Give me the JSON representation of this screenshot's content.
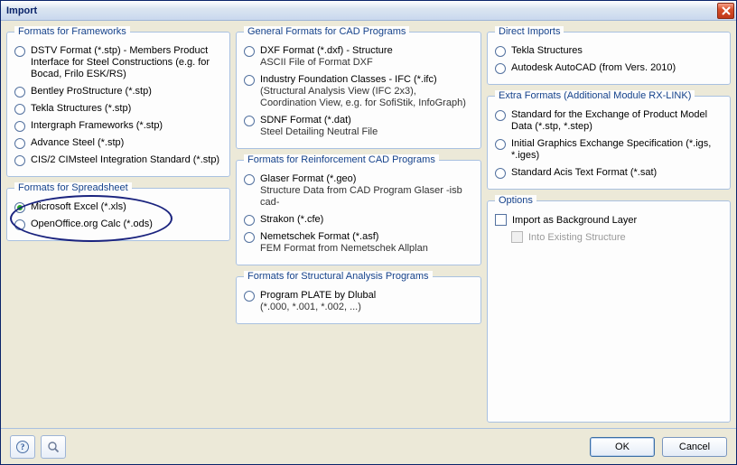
{
  "window": {
    "title": "Import"
  },
  "frameworks": {
    "legend": "Formats for Frameworks",
    "items": [
      {
        "label": "DSTV Format (*.stp) - Members Product Interface for Steel Constructions (e.g. for Bocad, Frilo ESK/RS)"
      },
      {
        "label": "Bentley ProStructure (*.stp)"
      },
      {
        "label": "Tekla Structures (*.stp)"
      },
      {
        "label": "Intergraph Frameworks (*.stp)"
      },
      {
        "label": "Advance Steel (*.stp)"
      },
      {
        "label": "CIS/2 CIMsteel Integration Standard (*.stp)"
      }
    ]
  },
  "spreadsheet": {
    "legend": "Formats for Spreadsheet",
    "items": [
      {
        "label": "Microsoft Excel (*.xls)",
        "selected": true
      },
      {
        "label": "OpenOffice.org Calc (*.ods)"
      }
    ]
  },
  "cad_general": {
    "legend": "General Formats for CAD Programs",
    "items": [
      {
        "label": "DXF Format (*.dxf) - Structure",
        "sub": "ASCII File of Format DXF"
      },
      {
        "label": "Industry Foundation Classes - IFC (*.ifc)",
        "sub": "(Structural Analysis View (IFC 2x3), Coordination View, e.g. for SofiStik, InfoGraph)"
      },
      {
        "label": "SDNF Format (*.dat)",
        "sub": "Steel Detailing Neutral File"
      }
    ]
  },
  "cad_reinf": {
    "legend": "Formats for Reinforcement CAD Programs",
    "items": [
      {
        "label": "Glaser Format (*.geo)",
        "sub": "Structure Data from CAD Program Glaser -isb cad-"
      },
      {
        "label": "Strakon (*.cfe)"
      },
      {
        "label": "Nemetschek Format (*.asf)",
        "sub": "FEM Format from Nemetschek Allplan"
      }
    ]
  },
  "struct_analysis": {
    "legend": "Formats for Structural Analysis Programs",
    "items": [
      {
        "label": "Program PLATE by Dlubal",
        "sub": "(*.000, *.001, *.002, ...)"
      }
    ]
  },
  "direct": {
    "legend": "Direct Imports",
    "items": [
      {
        "label": "Tekla Structures"
      },
      {
        "label": "Autodesk AutoCAD (from Vers. 2010)"
      }
    ]
  },
  "extra": {
    "legend": "Extra Formats (Additional Module RX-LINK)",
    "items": [
      {
        "label": "Standard for the Exchange of Product Model Data (*.stp, *.step)"
      },
      {
        "label": "Initial Graphics Exchange Specification (*.igs, *.iges)"
      },
      {
        "label": "Standard Acis Text Format (*.sat)"
      }
    ]
  },
  "options": {
    "legend": "Options",
    "bg_layer": "Import as Background Layer",
    "into_existing": "Into Existing Structure"
  },
  "buttons": {
    "ok": "OK",
    "cancel": "Cancel"
  }
}
